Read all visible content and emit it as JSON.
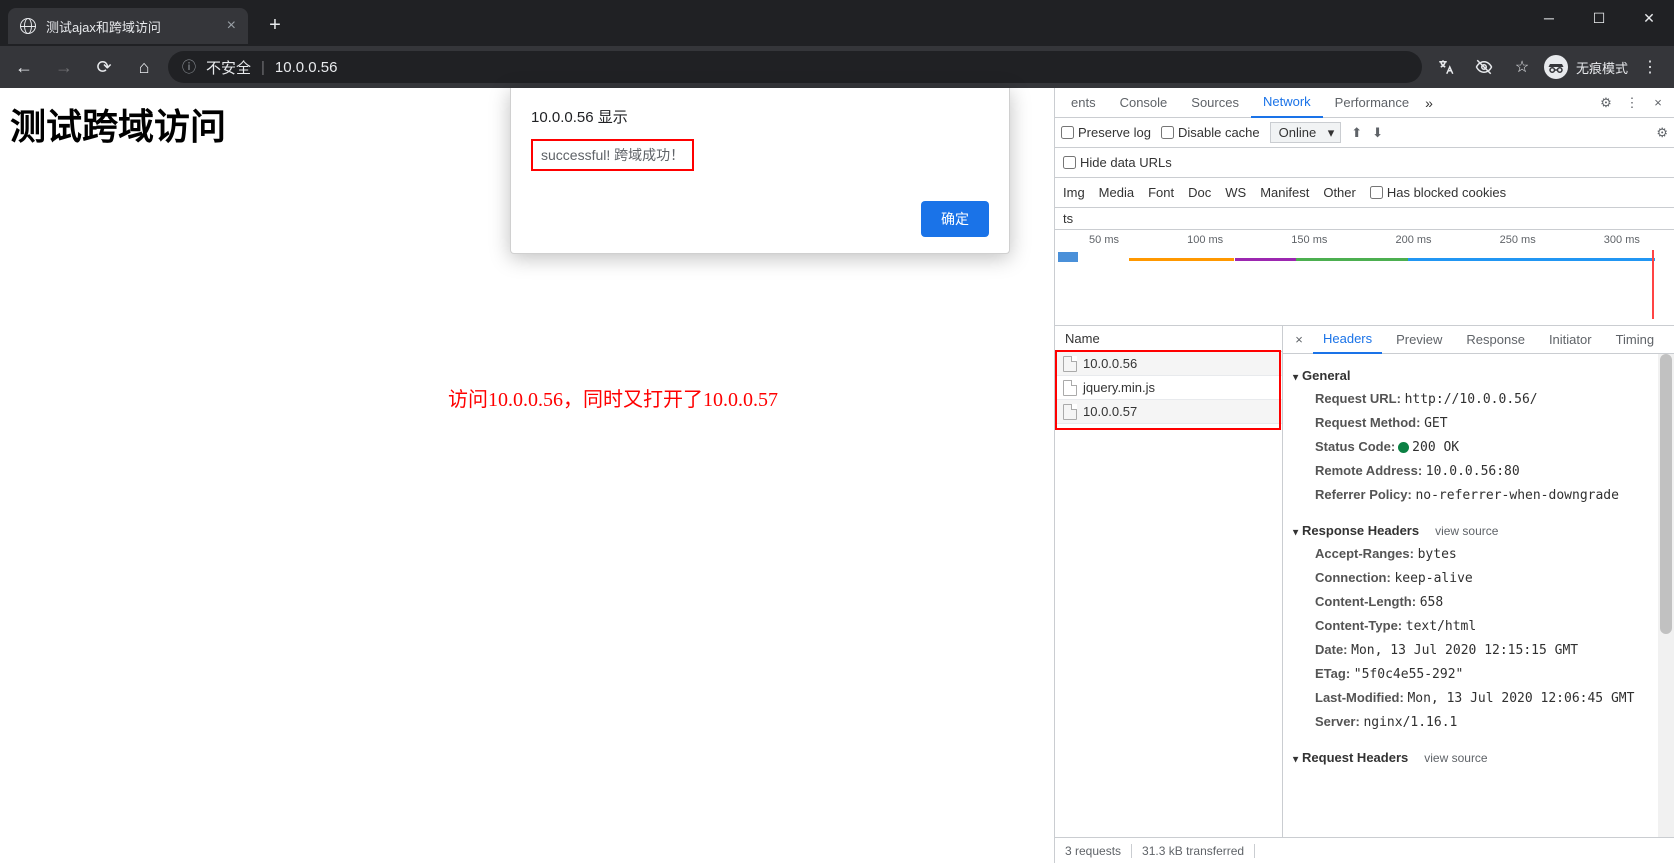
{
  "window": {
    "tab_title": "测试ajax和跨域访问",
    "incognito_label": "无痕模式"
  },
  "toolbar": {
    "insecure_label": "不安全",
    "url": "10.0.0.56"
  },
  "page": {
    "heading": "测试跨域访问",
    "annotation": "访问10.0.0.56，同时又打开了10.0.0.57"
  },
  "dialog": {
    "title": "10.0.0.56 显示",
    "message": "successful! 跨域成功！",
    "ok_label": "确定"
  },
  "devtools": {
    "tabs": {
      "elements_suffix": "ents",
      "console": "Console",
      "sources": "Sources",
      "network": "Network",
      "performance": "Performance"
    },
    "toolbar": {
      "preserve_log": "Preserve log",
      "disable_cache": "Disable cache",
      "online": "Online"
    },
    "filters": {
      "hide_data_urls": "Hide data URLs",
      "img": "Img",
      "media": "Media",
      "font": "Font",
      "doc": "Doc",
      "ws": "WS",
      "manifest": "Manifest",
      "other": "Other",
      "has_blocked": "Has blocked cookies",
      "trunc": "ts"
    },
    "waterfall_ticks": [
      "50 ms",
      "100 ms",
      "150 ms",
      "200 ms",
      "250 ms",
      "300 ms"
    ],
    "names": {
      "header": "Name",
      "rows": [
        "10.0.0.56",
        "jquery.min.js",
        "10.0.0.57"
      ]
    },
    "details": {
      "tabs": {
        "headers": "Headers",
        "preview": "Preview",
        "response": "Response",
        "initiator": "Initiator",
        "timing": "Timing"
      },
      "general": {
        "title": "General",
        "request_url_label": "Request URL:",
        "request_url": "http://10.0.0.56/",
        "request_method_label": "Request Method:",
        "request_method": "GET",
        "status_code_label": "Status Code:",
        "status_code": "200 OK",
        "remote_addr_label": "Remote Address:",
        "remote_addr": "10.0.0.56:80",
        "referrer_label": "Referrer Policy:",
        "referrer": "no-referrer-when-downgrade"
      },
      "response_headers": {
        "title": "Response Headers",
        "view_source": "view source",
        "accept_ranges_label": "Accept-Ranges:",
        "accept_ranges": "bytes",
        "connection_label": "Connection:",
        "connection": "keep-alive",
        "content_length_label": "Content-Length:",
        "content_length": "658",
        "content_type_label": "Content-Type:",
        "content_type": "text/html",
        "date_label": "Date:",
        "date": "Mon, 13 Jul 2020 12:15:15 GMT",
        "etag_label": "ETag:",
        "etag": "\"5f0c4e55-292\"",
        "last_modified_label": "Last-Modified:",
        "last_modified": "Mon, 13 Jul 2020 12:06:45 GMT",
        "server_label": "Server:",
        "server": "nginx/1.16.1"
      },
      "request_headers": {
        "title": "Request Headers",
        "view_source": "view source"
      }
    },
    "status": {
      "requests": "3 requests",
      "transferred": "31.3 kB transferred"
    }
  }
}
